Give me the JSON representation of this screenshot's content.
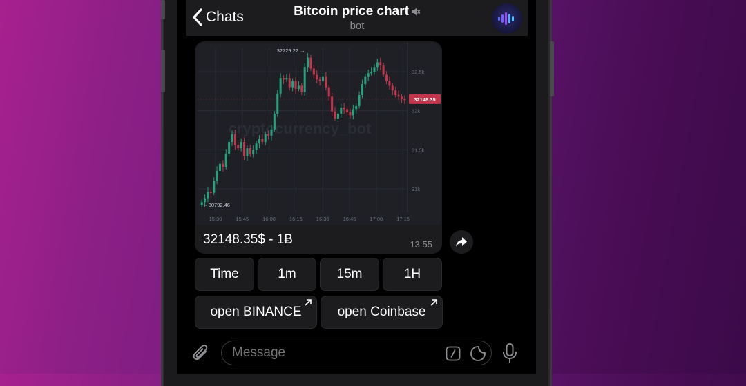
{
  "header": {
    "back_label": "Chats",
    "title": "Bitcoin price chart",
    "subtitle": "bot"
  },
  "message": {
    "caption": "32148.35$ - 1Ƀ",
    "time": "13:55"
  },
  "chart_data": {
    "type": "candlestick",
    "watermark": "cryptocurrency_bot",
    "x_ticks": [
      "15:30",
      "15:45",
      "16:00",
      "16:15",
      "16:30",
      "16:45",
      "17:00",
      "17:15"
    ],
    "y_ticks": [
      "32.5k",
      "32k",
      "31.5k",
      "31k"
    ],
    "ylim": [
      30700,
      32800
    ],
    "high_label": "32729.22",
    "low_label": "30792.46",
    "current_price_label": "32148.35",
    "colors": {
      "up": "#26a17b",
      "down": "#c2354b",
      "grid": "#2a2d35",
      "price_tag": "#c2354b"
    },
    "close_series": [
      30830,
      30880,
      30960,
      30950,
      31100,
      31230,
      31320,
      31280,
      31450,
      31600,
      31700,
      31560,
      31520,
      31600,
      31420,
      31520,
      31440,
      31500,
      31580,
      31640,
      31600,
      31700,
      31680,
      31760,
      31960,
      32220,
      32420,
      32400,
      32420,
      32300,
      32380,
      32280,
      32320,
      32240,
      32560,
      32680,
      32540,
      32460,
      32400,
      32380,
      32440,
      32300,
      32180,
      31990,
      31900,
      31960,
      32040,
      32020,
      31980,
      31940,
      32020,
      32060,
      32200,
      32340,
      32440,
      32480,
      32500,
      32560,
      32620,
      32580,
      32460,
      32380,
      32320,
      32260,
      32200,
      32180,
      32150,
      32148
    ]
  },
  "keyboard": {
    "row1": [
      "Time",
      "1m",
      "15m",
      "1H"
    ],
    "row2": [
      "open BINANCE",
      "open Coinbase"
    ]
  },
  "input": {
    "placeholder": "Message"
  },
  "icons": {
    "back": "chevron-left-icon",
    "muted": "speaker-muted-icon",
    "share": "share-arrow-icon",
    "attach": "paperclip-icon",
    "commands": "slash-command-icon",
    "sticker": "sticker-icon",
    "mic": "microphone-icon"
  }
}
